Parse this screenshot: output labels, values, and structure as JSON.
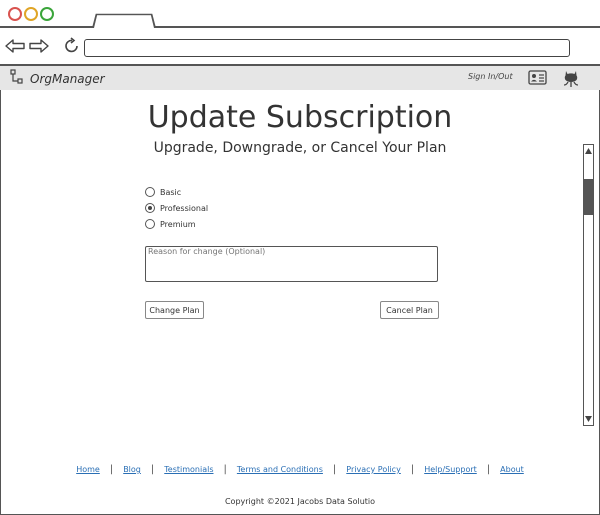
{
  "app": {
    "brand": "OrgManager",
    "signin_label": "Sign In/Out"
  },
  "main": {
    "title": "Update Subscription",
    "subtitle": "Upgrade, Downgrade, or Cancel Your Plan",
    "plans": [
      {
        "label": "Basic",
        "selected": false
      },
      {
        "label": "Professional",
        "selected": true
      },
      {
        "label": "Premium",
        "selected": false
      }
    ],
    "reason_placeholder": "Reason for change (Optional)",
    "change_label": "Change Plan",
    "cancel_label": "Cancel Plan"
  },
  "footer": {
    "links": [
      "Home",
      "Blog",
      "Testimonials",
      "Terms and Conditions",
      "Privacy Policy",
      "Help/Support",
      "About"
    ],
    "copyright": "Copyright ©2021 Jacobs Data Solutio"
  },
  "colors": {
    "close": "#d9534f",
    "minimize": "#e0a526",
    "maximize": "#3aa53a",
    "link": "#2a6fb5",
    "appbar": "#e6e6e6"
  },
  "icons": [
    "back-arrow-icon",
    "forward-arrow-icon",
    "reload-icon",
    "org-chart-icon",
    "contact-card-icon",
    "github-octocat-icon",
    "scroll-up-icon",
    "scroll-down-icon"
  ]
}
